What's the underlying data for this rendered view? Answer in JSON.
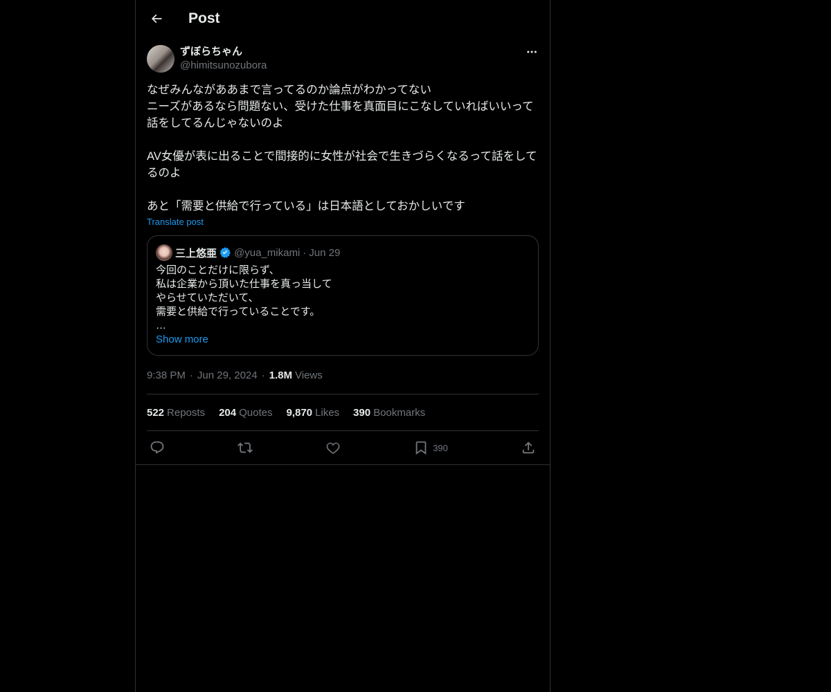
{
  "header": {
    "title": "Post"
  },
  "post": {
    "author": {
      "display_name": "ずぼらちゃん",
      "handle": "@himitsunozubora"
    },
    "text": "なぜみんながああまで言ってるのか論点がわかってない\nニーズがあるなら問題ない、受けた仕事を真面目にこなしていればいいって話をしてるんじゃないのよ\n\nAV女優が表に出ることで間接的に女性が社会で生きづらくなるって話をしてるのよ\n\nあと「需要と供給で行っている」は日本語としておかしいです",
    "translate_label": "Translate post",
    "quote": {
      "display_name": "三上悠亜",
      "handle": "@yua_mikami",
      "dot": "·",
      "date": "Jun 29",
      "text": "今回のことだけに限らず、\n私は企業から頂いた仕事を真っ当して\nやらせていただいて、\n需要と供給で行っていることです。\n…",
      "show_more_label": "Show more"
    },
    "meta": {
      "time": "9:38 PM",
      "date": "Jun 29, 2024",
      "sep": "·",
      "views_count": "1.8M",
      "views_label": "Views"
    },
    "stats": [
      {
        "num": "522",
        "label": "Reposts"
      },
      {
        "num": "204",
        "label": "Quotes"
      },
      {
        "num": "9,870",
        "label": "Likes"
      },
      {
        "num": "390",
        "label": "Bookmarks"
      }
    ],
    "actions": {
      "bookmark_count": "390"
    }
  },
  "colors": {
    "background": "#000000",
    "text": "#e7e9ea",
    "secondary": "#71767b",
    "accent": "#1d9bf0",
    "border": "#2f3336"
  },
  "icons": [
    "back-arrow-icon",
    "more-icon",
    "verified-badge-icon",
    "reply-icon",
    "repost-icon",
    "like-icon",
    "bookmark-icon",
    "share-icon"
  ]
}
